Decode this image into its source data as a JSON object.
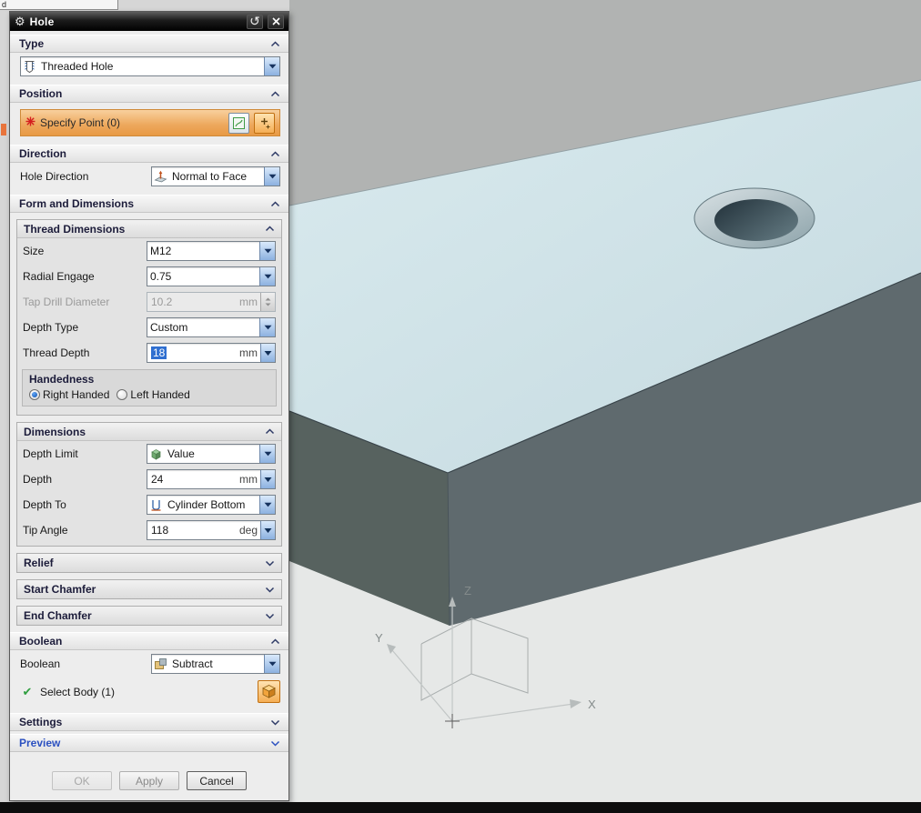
{
  "colors": {
    "accent_orange": "#ee9a4d",
    "selection_blue": "#2f6fd0",
    "dropdown_blue": "#8cb1e0",
    "plate_top_face": "#cfe2e7",
    "plate_front_face": "#5f6a6e",
    "viewport_background": "#e6e8e7",
    "top_band_gray": "#b1b3b2",
    "titlebar_black": "#000000",
    "preview_blue": "#2b50c0",
    "required_red": "#d41f1f",
    "check_green": "#2f9e3f"
  },
  "fragment": {
    "label": "d"
  },
  "icons": {
    "gear": "⚙",
    "undo": "↺",
    "check": "✔"
  },
  "dialog": {
    "title": "Hole",
    "type": {
      "header": "Type",
      "value": "Threaded Hole"
    },
    "position": {
      "header": "Position",
      "specify_point": "Specify Point (0)"
    },
    "direction": {
      "header": "Direction",
      "label": "Hole Direction",
      "value": "Normal to Face"
    },
    "form": {
      "header": "Form and Dimensions"
    },
    "thread": {
      "header": "Thread Dimensions",
      "rows": {
        "size": {
          "label": "Size",
          "value": "M12"
        },
        "radial_engage": {
          "label": "Radial Engage",
          "value": "0.75"
        },
        "tap_drill": {
          "label": "Tap Drill Diameter",
          "value": "10.2",
          "unit": "mm"
        },
        "depth_type": {
          "label": "Depth Type",
          "value": "Custom"
        },
        "thread_depth": {
          "label": "Thread Depth",
          "value": "18",
          "unit": "mm"
        }
      },
      "handedness": {
        "header": "Handedness",
        "right": "Right Handed",
        "left": "Left Handed"
      }
    },
    "dimensions": {
      "header": "Dimensions",
      "rows": {
        "depth_limit": {
          "label": "Depth Limit",
          "value": "Value"
        },
        "depth": {
          "label": "Depth",
          "value": "24",
          "unit": "mm"
        },
        "depth_to": {
          "label": "Depth To",
          "value": "Cylinder Bottom"
        },
        "tip_angle": {
          "label": "Tip Angle",
          "value": "118",
          "unit": "deg"
        }
      }
    },
    "relief": {
      "header": "Relief"
    },
    "start_chamfer": {
      "header": "Start Chamfer"
    },
    "end_chamfer": {
      "header": "End Chamfer"
    },
    "boolean": {
      "header": "Boolean",
      "label": "Boolean",
      "value": "Subtract",
      "select_body": "Select Body (1)"
    },
    "settings": {
      "header": "Settings"
    },
    "preview": {
      "header": "Preview"
    },
    "buttons": {
      "ok": "OK",
      "apply": "Apply",
      "cancel": "Cancel"
    }
  },
  "viewport": {
    "axes": {
      "x": "X",
      "y": "Y",
      "z": "Z"
    }
  }
}
